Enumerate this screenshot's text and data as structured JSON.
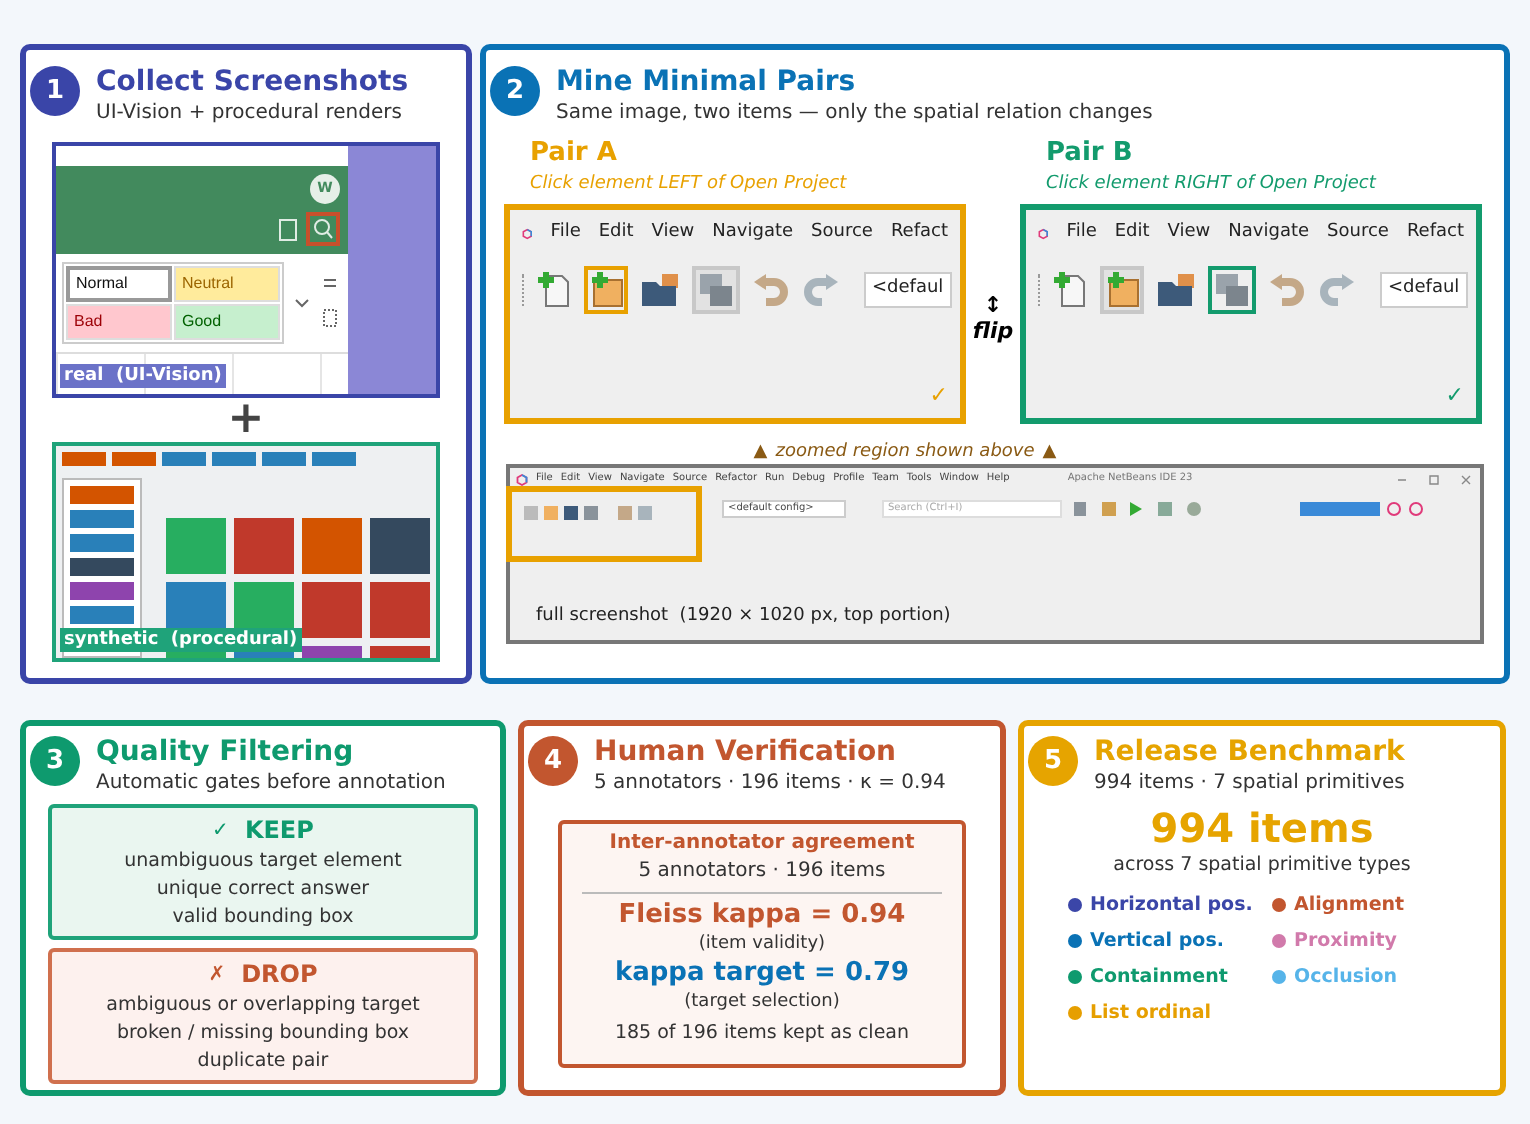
{
  "collect": {
    "number": "1",
    "title": "Collect Screenshots",
    "subtitle": "UI-Vision + procedural renders",
    "real": {
      "label": "real  (UI-Vision)",
      "avatar": "W",
      "styles": [
        {
          "kind": "normal",
          "text": "Normal"
        },
        {
          "kind": "neutral",
          "text": "Neutral"
        },
        {
          "kind": "bad",
          "text": "Bad"
        },
        {
          "kind": "good",
          "text": "Good"
        }
      ]
    },
    "plus": "+",
    "synthetic": {
      "label": "synthetic  (procedural)"
    }
  },
  "mine": {
    "number": "2",
    "title": "Mine Minimal Pairs",
    "subtitle": "Same image, two items — only the spatial relation changes",
    "pairs": [
      {
        "title": "Pair A",
        "instruction": "Click element LEFT of Open Project",
        "color": "#e8a100",
        "menu": [
          "File",
          "Edit",
          "View",
          "Navigate",
          "Source",
          "Refact"
        ],
        "icons": [
          {
            "kind": "new-file",
            "target": false,
            "anchor": false
          },
          {
            "kind": "new-project",
            "target": true,
            "anchor": false
          },
          {
            "kind": "folder",
            "target": false,
            "anchor": false
          },
          {
            "kind": "windows",
            "target": false,
            "anchor": true
          },
          {
            "kind": "undo",
            "target": false,
            "anchor": false
          },
          {
            "kind": "redo",
            "target": false,
            "anchor": false
          }
        ],
        "field": "<defaul",
        "check": "✓"
      },
      {
        "title": "Pair B",
        "instruction": "Click element RIGHT of Open Project",
        "color": "#139b6d",
        "menu": [
          "File",
          "Edit",
          "View",
          "Navigate",
          "Source",
          "Refact"
        ],
        "icons": [
          {
            "kind": "new-file",
            "target": false,
            "anchor": false
          },
          {
            "kind": "new-project",
            "target": false,
            "anchor": true
          },
          {
            "kind": "folder",
            "target": false,
            "anchor": false
          },
          {
            "kind": "windows",
            "target": true,
            "anchor": false
          },
          {
            "kind": "undo",
            "target": false,
            "anchor": false
          },
          {
            "kind": "redo",
            "target": false,
            "anchor": false
          }
        ],
        "field": "<defaul",
        "check": "✓"
      }
    ],
    "flip": {
      "arrow": "↕",
      "label": "flip"
    },
    "zoom_note": {
      "left": "▲",
      "text": "zoomed region shown above",
      "right": "▲"
    },
    "full": {
      "menu": [
        "File",
        "Edit",
        "View",
        "Navigate",
        "Source",
        "Refactor",
        "Run",
        "Debug",
        "Profile",
        "Team",
        "Tools",
        "Window",
        "Help"
      ],
      "title": "Apache NetBeans IDE 23",
      "config": "<default config>",
      "search": "Search (Ctrl+I)",
      "caption": "full screenshot  (1920 × 1020 px, top portion)"
    }
  },
  "filtering": {
    "number": "3",
    "title": "Quality Filtering",
    "subtitle": "Automatic gates before annotation",
    "gates": [
      {
        "kind": "keep",
        "mark": "✓",
        "label": "KEEP",
        "lines": [
          "unambiguous target element",
          "unique correct answer",
          "valid bounding box"
        ]
      },
      {
        "kind": "drop",
        "mark": "✗",
        "label": "DROP",
        "lines": [
          "ambiguous or overlapping target",
          "broken / missing bounding box",
          "duplicate pair"
        ]
      }
    ]
  },
  "verification": {
    "number": "4",
    "title": "Human Verification",
    "subtitle": "5 annotators · 196 items · κ = 0.94",
    "card": {
      "title": "Inter-annotator agreement",
      "subtitle": "5 annotators · 196 items",
      "metrics": [
        {
          "kind": "primary",
          "value": "Fleiss kappa = 0.94",
          "note": "(item validity)"
        },
        {
          "kind": "secondary",
          "value": "kappa target = 0.79",
          "note": "(target selection)"
        }
      ],
      "footer": "185 of 196 items kept as clean"
    }
  },
  "release": {
    "number": "5",
    "title": "Release Benchmark",
    "subtitle": "994 items · 7 spatial primitives",
    "headline": "994 items",
    "caption": "across 7 spatial primitive types",
    "primitives": [
      {
        "label": "Horizontal pos.",
        "color": "#3b46a8"
      },
      {
        "label": "Alignment",
        "color": "#c2562f"
      },
      {
        "label": "Vertical pos.",
        "color": "#0a72b5"
      },
      {
        "label": "Proximity",
        "color": "#d17aab"
      },
      {
        "label": "Containment",
        "color": "#0e9a6e"
      },
      {
        "label": "Occlusion",
        "color": "#56b4e9"
      },
      {
        "label": "List ordinal",
        "color": "#e69f00"
      }
    ]
  }
}
